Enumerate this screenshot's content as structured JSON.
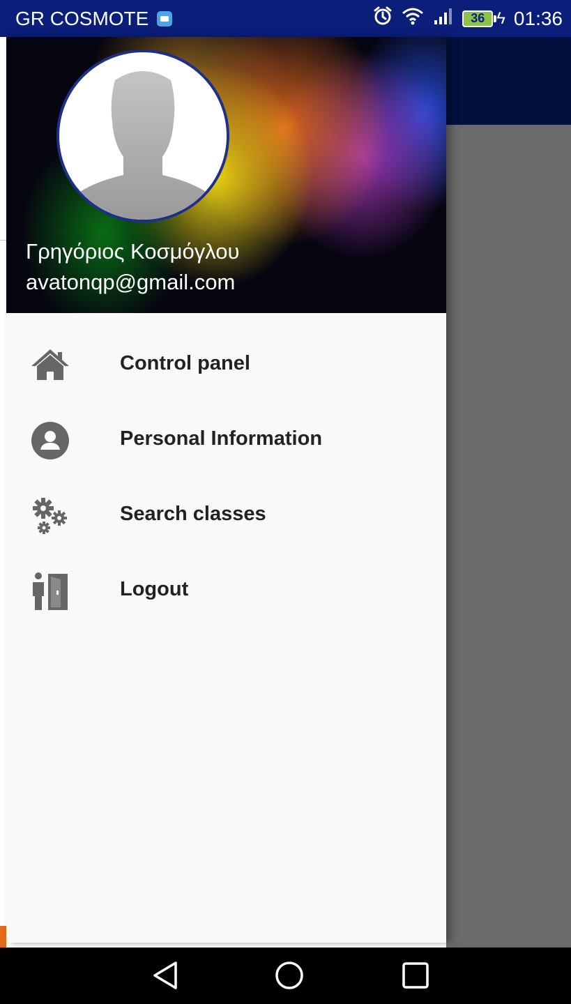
{
  "status_bar": {
    "carrier": "GR COSMOTE",
    "battery_level": "36",
    "time": "01:36"
  },
  "drawer": {
    "user": {
      "name": "Γρηγόριος Κοσμόγλου",
      "email": "avatonqp@gmail.com"
    },
    "menu_items": [
      {
        "label": "Control panel",
        "icon": "home-icon"
      },
      {
        "label": "Personal Information",
        "icon": "user-circle-icon"
      },
      {
        "label": "Search classes",
        "icon": "gears-icon"
      },
      {
        "label": "Logout",
        "icon": "exit-door-icon"
      }
    ]
  },
  "nav_bar": {
    "buttons": [
      "back-icon",
      "home-circle-icon",
      "recents-icon"
    ]
  },
  "colors": {
    "status_bar": "#0b1f7a",
    "toolbar": "#03103f",
    "scrim": "#6a6a6a",
    "drawer_bg": "#f9f9f9",
    "menu_text": "#222222",
    "icon_gray": "#666666"
  }
}
